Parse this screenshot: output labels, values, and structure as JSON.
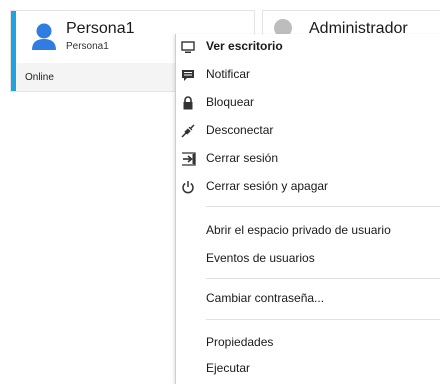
{
  "users": [
    {
      "name": "Persona1",
      "subtitle": "Persona1",
      "status": "Online",
      "accent": "#1fa2df",
      "avatar_color": "#2f7de1"
    },
    {
      "name": "Administrador",
      "avatar_color": "#bdbdbd"
    }
  ],
  "menu": {
    "items": [
      {
        "label": "Ver escritorio",
        "icon": "monitor-icon",
        "bold": true
      },
      {
        "label": "Notificar",
        "icon": "message-icon"
      },
      {
        "label": "Bloquear",
        "icon": "lock-icon"
      },
      {
        "label": "Desconectar",
        "icon": "disconnect-plug-icon"
      },
      {
        "label": "Cerrar sesión",
        "icon": "sign-out-icon"
      },
      {
        "label": "Cerrar sesión y apagar",
        "icon": "power-icon"
      },
      {
        "label": "Abrir el espacio privado de usuario"
      },
      {
        "label": "Eventos de usuarios"
      },
      {
        "label": "Cambiar contraseña..."
      },
      {
        "label": "Propiedades"
      },
      {
        "label": "Ejecutar"
      }
    ]
  }
}
